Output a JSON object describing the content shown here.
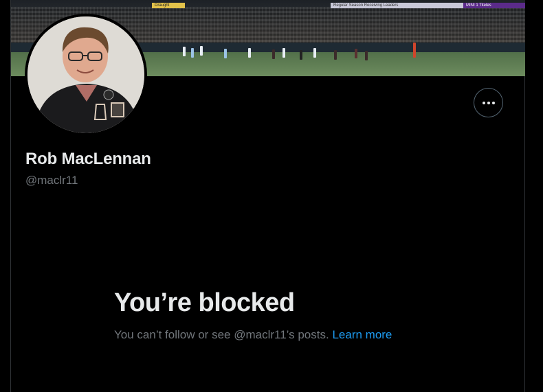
{
  "profile": {
    "display_name": "Rob MacLennan",
    "handle": "@maclr11"
  },
  "banner": {
    "board_left": "Draught",
    "board_center": "Regular Season Receiving Leaders",
    "board_right": "MINI 1 Titeles"
  },
  "actions": {
    "more_icon": "more-horizontal-icon"
  },
  "blocked": {
    "title": "You’re blocked",
    "message": "You can’t follow or see @maclr11’s posts.",
    "learn_more_label": "Learn more"
  },
  "colors": {
    "background": "#000000",
    "text_primary": "#e7e9ea",
    "text_secondary": "#71767b",
    "link": "#1d9bf0",
    "border": "#2f3336"
  }
}
